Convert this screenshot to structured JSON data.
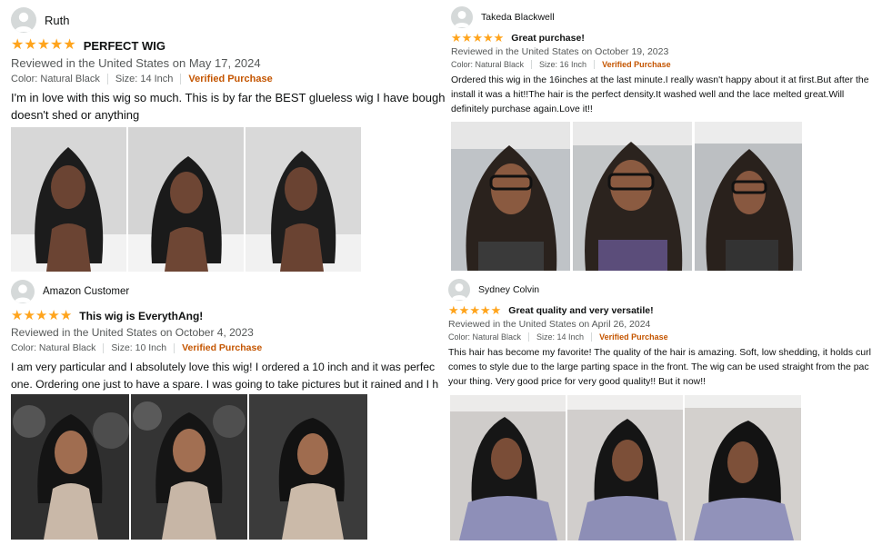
{
  "accent": {
    "star": "#ffa41c",
    "verified": "#c45500",
    "avatar_bg": "#d5d9d9"
  },
  "reviews": [
    {
      "reviewer": "Ruth",
      "stars": 5,
      "title": "PERFECT WIG",
      "date": "Reviewed in the United States on May 17, 2024",
      "color": "Color: Natural Black",
      "size": "Size: 14 Inch",
      "verified": "Verified Purchase",
      "body": "I'm in love with this wig so much. This is by far the BEST glueless wig I have bough doesn't shed or anything"
    },
    {
      "reviewer": "Takeda Blackwell",
      "stars": 5,
      "title": "Great purchase!",
      "date": "Reviewed in the United States on October 19, 2023",
      "color": "Color: Natural Black",
      "size": "Size: 16 Inch",
      "verified": "Verified Purchase",
      "body": "Ordered this wig in the 16inches at the last minute.I really wasn't happy about it at first.But after the install it was a hit!!The hair is the perfect density.It washed well and the lace melted great.Will definitely purchase again.Love it!!"
    },
    {
      "reviewer": "Amazon Customer",
      "stars": 5,
      "title": "This wig is EverythAng!",
      "date": "Reviewed in the United States on October 4, 2023",
      "color": "Color: Natural Black",
      "size": "Size: 10 Inch",
      "verified": "Verified Purchase",
      "body": "I am very particular and I absolutely love this wig! I ordered a 10 inch and it was perfec one. Ordering one just to have a spare. I was going to take pictures but it rained and I h"
    },
    {
      "reviewer": "Sydney Colvin",
      "stars": 5,
      "title": "Great quality and very versatile!",
      "date": "Reviewed in the United States on April 26, 2024",
      "color": "Color: Natural Black",
      "size": "Size: 14 Inch",
      "verified": "Verified Purchase",
      "body": "This hair has become my favorite! The quality of the hair is amazing. Soft, low shedding, it holds curl comes to style due to the large parting space in the front. The wig can be used straight from the pac your thing. Very good price for very good quality!! But it now!!"
    }
  ]
}
